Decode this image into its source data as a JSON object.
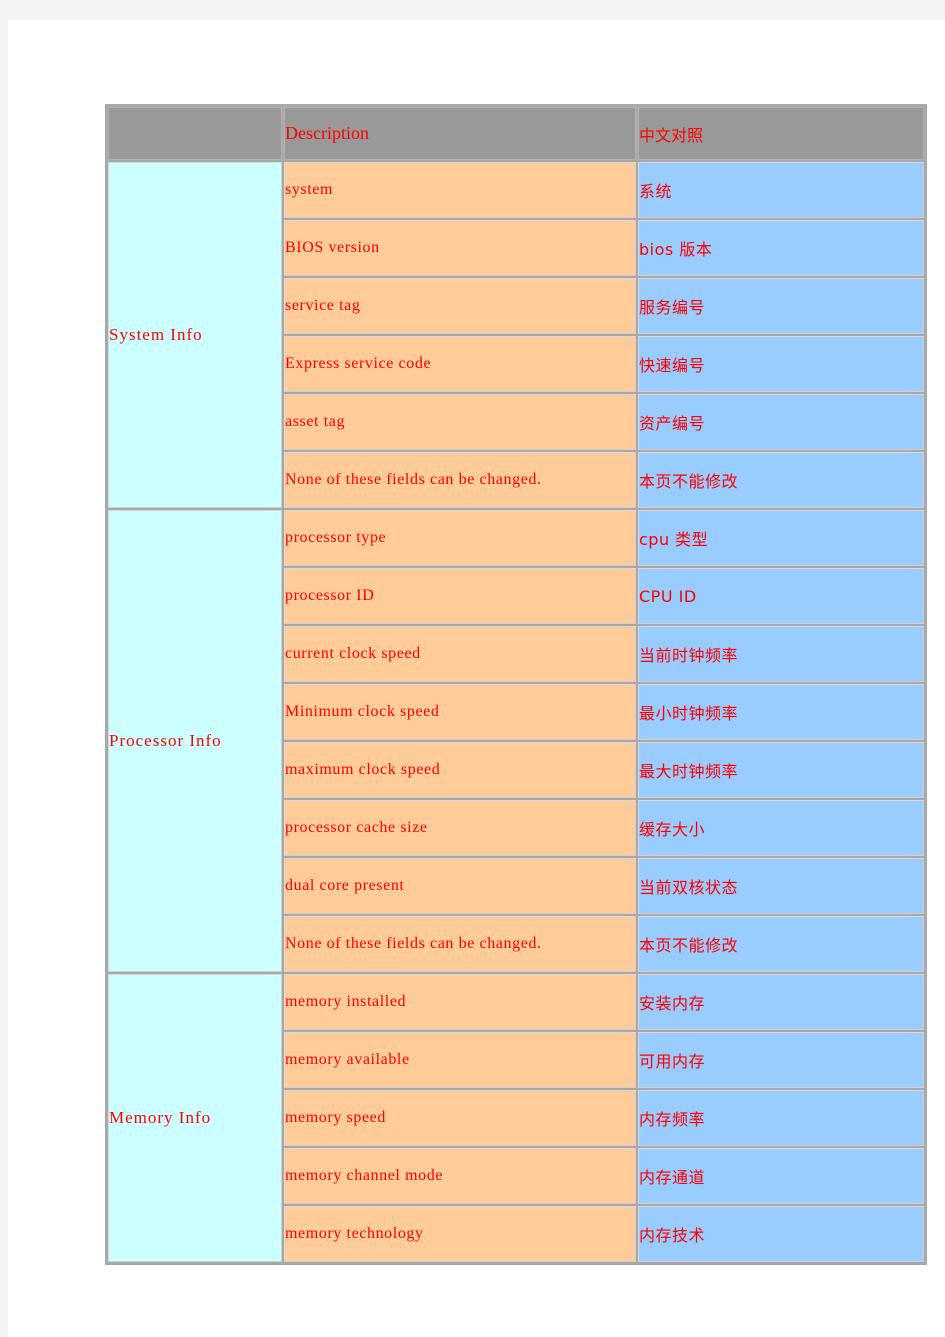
{
  "table": {
    "headers": {
      "label_blank": "",
      "description": "Description",
      "chinese": "中文对照"
    },
    "groups": [
      {
        "label": "System Info",
        "rows": [
          {
            "description": "system",
            "chinese": "系统"
          },
          {
            "description": "BIOS version",
            "chinese": "bios 版本"
          },
          {
            "description": "service tag",
            "chinese": "服务编号"
          },
          {
            "description": "Express service code",
            "chinese": "快速编号"
          },
          {
            "description": "asset tag",
            "chinese": "资产编号"
          },
          {
            "description": "None of these fields can be changed.",
            "chinese": "本页不能修改"
          }
        ]
      },
      {
        "label": "Processor Info",
        "rows": [
          {
            "description": "processor type",
            "chinese": "cpu 类型"
          },
          {
            "description": "processor ID",
            "chinese": "CPU ID"
          },
          {
            "description": "current clock speed",
            "chinese": "当前时钟频率"
          },
          {
            "description": "Minimum clock speed",
            "chinese": "最小时钟频率"
          },
          {
            "description": "maximum clock speed",
            "chinese": "最大时钟频率"
          },
          {
            "description": "processor cache size",
            "chinese": "缓存大小"
          },
          {
            "description": "dual core present",
            "chinese": "当前双核状态"
          },
          {
            "description": "None of these fields can be changed.",
            "chinese": "本页不能修改"
          }
        ]
      },
      {
        "label": "Memory Info",
        "rows": [
          {
            "description": "memory installed",
            "chinese": "安装内存"
          },
          {
            "description": "memory available",
            "chinese": "可用内存"
          },
          {
            "description": "memory speed",
            "chinese": "内存频率"
          },
          {
            "description": "memory channel mode",
            "chinese": "内存通道"
          },
          {
            "description": "memory technology",
            "chinese": "内存技术"
          }
        ]
      }
    ],
    "colors": {
      "header_bg": "#999999",
      "label_bg": "#ccffff",
      "description_bg": "#ffcc99",
      "chinese_bg": "#99ccff",
      "text": "#ff0000",
      "grid": "#a8a8a8"
    }
  }
}
